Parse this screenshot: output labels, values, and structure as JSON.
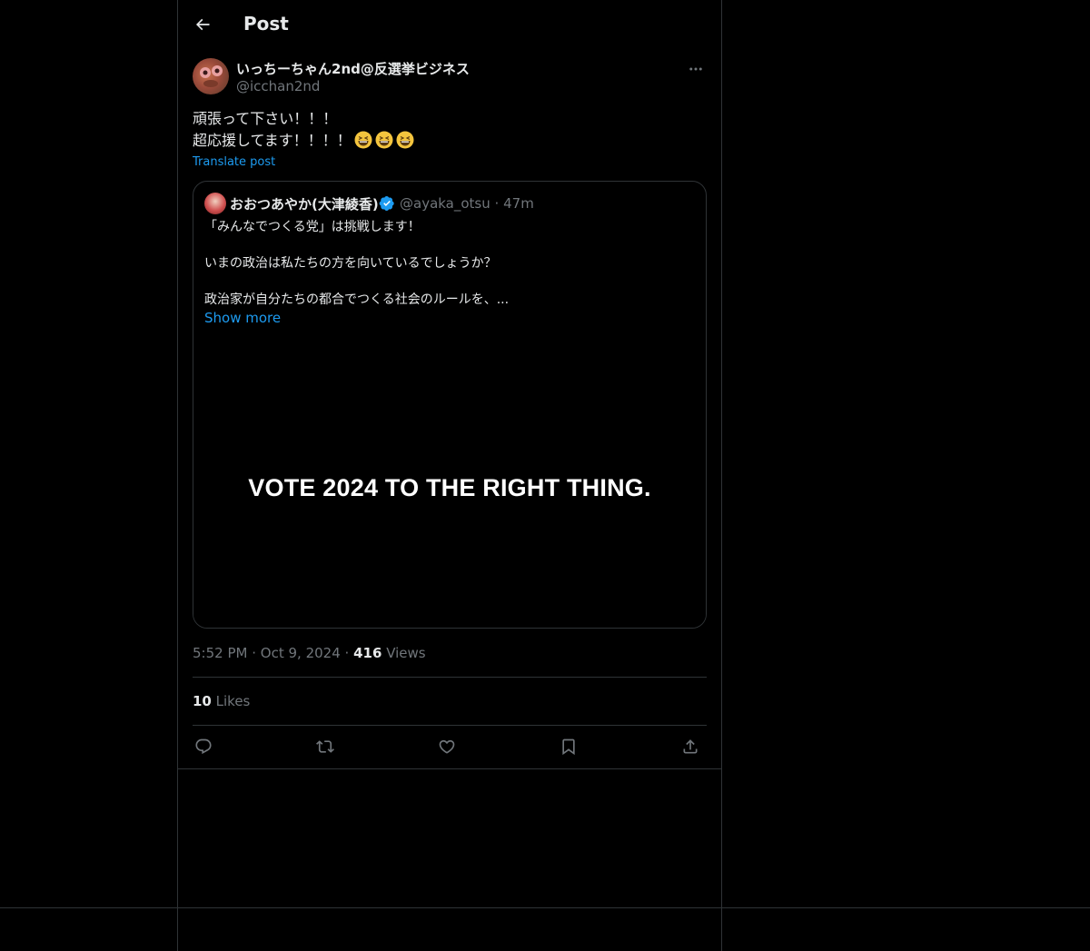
{
  "header": {
    "title": "Post",
    "back_icon": "arrow-left-icon"
  },
  "post": {
    "author": {
      "display_name": "いっちーちゃん2nd@反選挙ビジネス",
      "handle": "@icchan2nd"
    },
    "text_line1": "頑張って下さい！！！",
    "text_line2": "超応援してます！！！！",
    "emoji_count": 3,
    "translate_label": "Translate post",
    "quote": {
      "display_name": "おおつあやか(大津綾香)",
      "verified": true,
      "handle": "@ayaka_otsu",
      "separator": "·",
      "time": "47m",
      "paragraph1": "「みんなでつくる党」は挑戦します！",
      "paragraph2": "いまの政治は私たちの方を向いているでしょうか？",
      "paragraph3": "政治家が自分たちの都合でつくる社会のルールを、...",
      "show_more_label": "Show more",
      "media_text": "VOTE 2024 TO THE RIGHT THING."
    },
    "meta": {
      "time": "5:52 PM",
      "dot1": "·",
      "date": "Oct 9, 2024",
      "dot2": "·",
      "views_count": "416",
      "views_label": "Views"
    },
    "likes": {
      "count": "10",
      "label": "Likes"
    },
    "actions": [
      "reply-icon",
      "repost-icon",
      "like-icon",
      "bookmark-icon",
      "share-icon"
    ]
  },
  "colors": {
    "background": "#000000",
    "text": "#e7e9ea",
    "secondary": "#71767b",
    "accent": "#1d9bf0",
    "border": "#2f3336"
  }
}
